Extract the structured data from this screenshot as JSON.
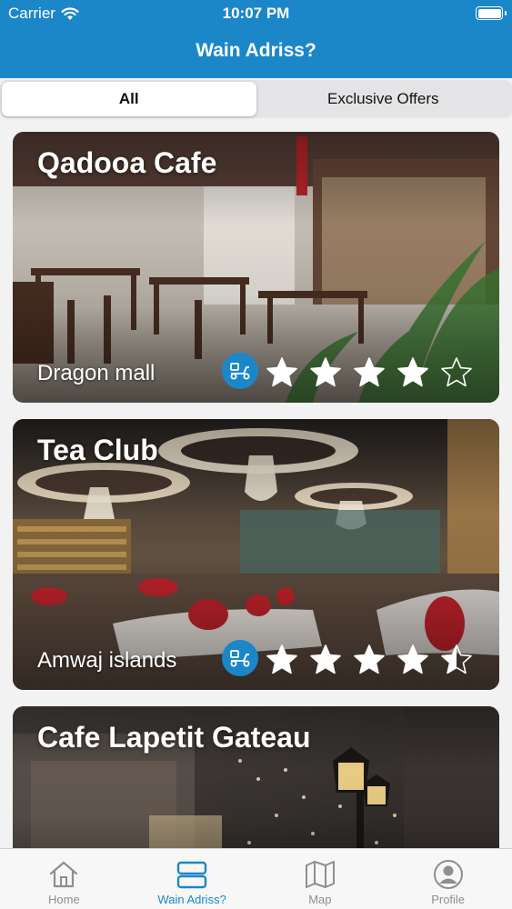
{
  "status_bar": {
    "carrier": "Carrier",
    "time": "10:07 PM"
  },
  "nav": {
    "title": "Wain Adriss?"
  },
  "segments": [
    {
      "label": "All",
      "selected": true
    },
    {
      "label": "Exclusive Offers",
      "selected": false
    }
  ],
  "places": [
    {
      "name": "Qadooa Cafe",
      "location": "Dragon mall",
      "rating": 4,
      "delivery": true
    },
    {
      "name": "Tea Club",
      "location": "Amwaj islands",
      "rating": 4.5,
      "delivery": true
    },
    {
      "name": "Cafe Lapetit Gateau"
    }
  ],
  "tabs": [
    {
      "label": "Home",
      "icon": "home-icon",
      "active": false
    },
    {
      "label": "Wain Adriss?",
      "icon": "list-icon",
      "active": true
    },
    {
      "label": "Map",
      "icon": "map-icon",
      "active": false
    },
    {
      "label": "Profile",
      "icon": "profile-icon",
      "active": false
    }
  ],
  "colors": {
    "accent": "#1b87c9",
    "tab_inactive": "#8e8e93",
    "background": "#f2f2f2"
  }
}
